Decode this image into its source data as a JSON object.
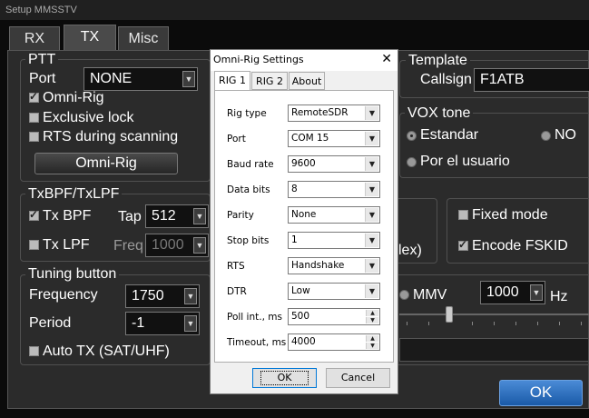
{
  "outer": {
    "title": "Setup MMSSTV",
    "tabs": [
      "RX",
      "TX",
      "Misc"
    ],
    "ptt": {
      "title": "PTT",
      "port_label": "Port",
      "port_value": "NONE",
      "omni_rig_label": "Omni-Rig",
      "exclusive_lock_label": "Exclusive lock",
      "rts_label": "RTS during scanning",
      "omni_rig_button": "Omni-Rig"
    },
    "template": {
      "title": "Template",
      "callsign_label": "Callsign",
      "callsign_value": "F1ATB"
    },
    "vox": {
      "title": "VOX tone",
      "estandar_label": "Estandar",
      "no_label": "NO",
      "por_usuario_label": "Por el usuario"
    },
    "bpf": {
      "title": "TxBPF/TxLPF",
      "tx_bpf_label": "Tx BPF",
      "tap_label": "Tap",
      "tap_value": "512",
      "tx_lpf_label": "Tx LPF",
      "freq_label": "Freq",
      "freq_value": "1000"
    },
    "fsk": {
      "fixed_mode_label": "Fixed mode",
      "encode_fskid_label": "Encode FSKID",
      "lex_fragment": "lex)"
    },
    "tuning": {
      "title": "Tuning button",
      "frequency_label": "Frequency",
      "frequency_value": "1750",
      "period_label": "Period",
      "period_value": "-1",
      "auto_tx_label": "Auto TX (SAT/UHF)"
    },
    "mmv": {
      "label": "MMV",
      "value": "1000",
      "unit": "Hz"
    },
    "ok_label": "OK"
  },
  "dialog": {
    "title": "Omni-Rig Settings",
    "close_glyph": "✕",
    "tabs": [
      "RIG 1",
      "RIG 2",
      "About"
    ],
    "fields": [
      {
        "label": "Rig type",
        "value": "RemoteSDR"
      },
      {
        "label": "Port",
        "value": "COM 15"
      },
      {
        "label": "Baud rate",
        "value": "9600"
      },
      {
        "label": "Data bits",
        "value": "8"
      },
      {
        "label": "Parity",
        "value": "None"
      },
      {
        "label": "Stop bits",
        "value": "1"
      },
      {
        "label": "RTS",
        "value": "Handshake"
      },
      {
        "label": "DTR",
        "value": "Low"
      },
      {
        "label": "Poll int., ms",
        "value": "500"
      },
      {
        "label": "Timeout, ms",
        "value": "4000"
      }
    ],
    "ok_label": "OK",
    "cancel_label": "Cancel"
  }
}
